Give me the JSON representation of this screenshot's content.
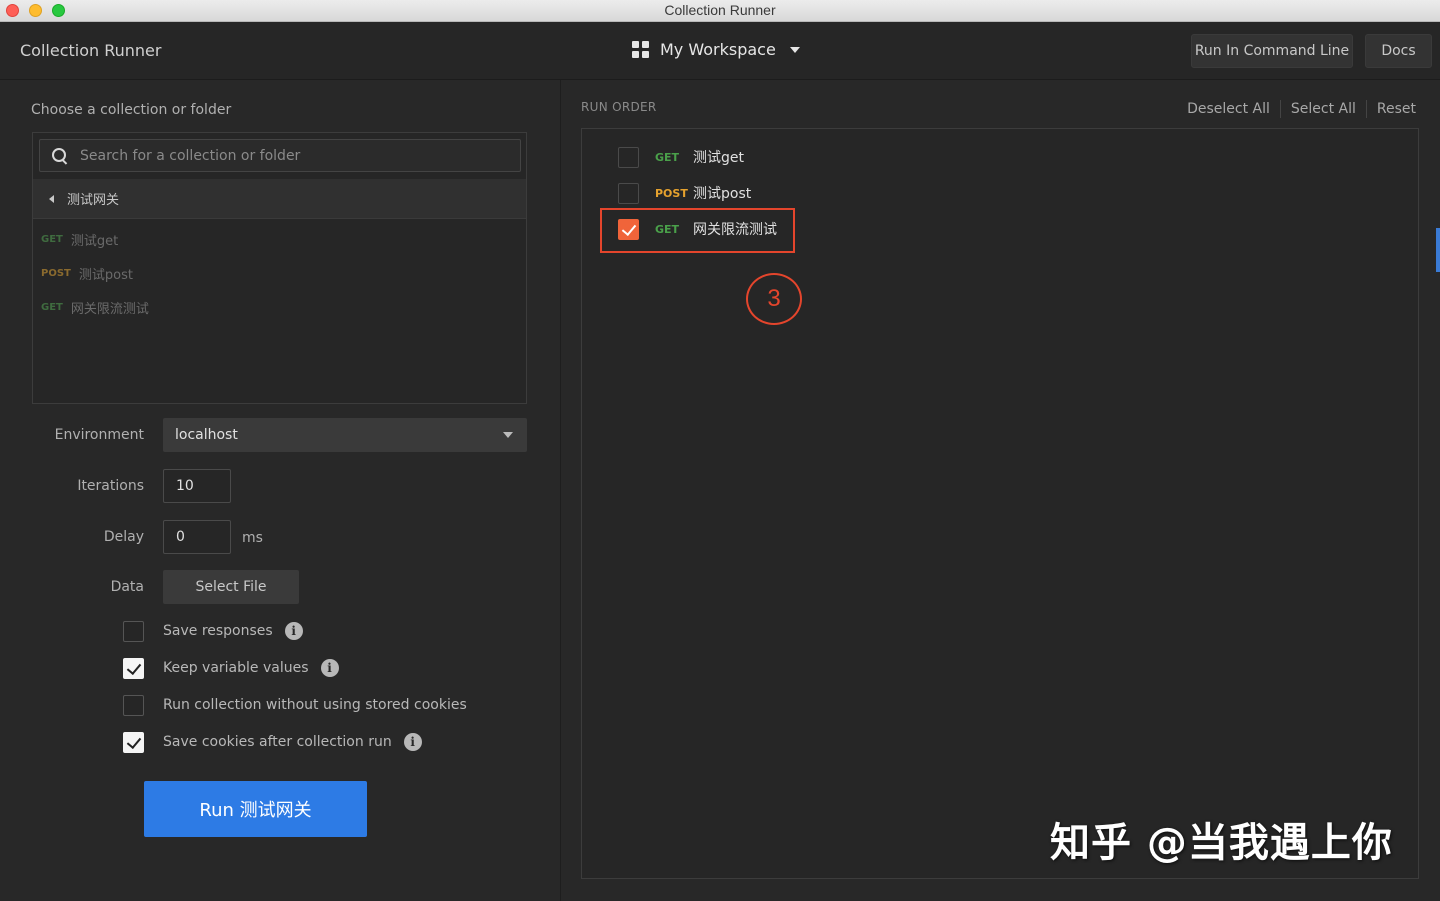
{
  "window": {
    "title": "Collection Runner"
  },
  "header": {
    "app_title": "Collection Runner",
    "workspace": "My Workspace",
    "run_cmd_label": "Run In Command Line",
    "docs_label": "Docs"
  },
  "left": {
    "choose_label": "Choose a collection or folder",
    "search_placeholder": "Search for a collection or folder",
    "folder": "测试网关",
    "items": [
      {
        "method": "GET",
        "name": "测试get"
      },
      {
        "method": "POST",
        "name": "测试post"
      },
      {
        "method": "GET",
        "name": "网关限流测试"
      }
    ],
    "environment_label": "Environment",
    "environment_value": "localhost",
    "iterations_label": "Iterations",
    "iterations_value": "10",
    "delay_label": "Delay",
    "delay_value": "0",
    "delay_unit": "ms",
    "data_label": "Data",
    "select_file_label": "Select File",
    "options": [
      {
        "label": "Save responses",
        "checked": false,
        "info": true
      },
      {
        "label": "Keep variable values",
        "checked": true,
        "info": true
      },
      {
        "label": "Run collection without using stored cookies",
        "checked": false,
        "info": false
      },
      {
        "label": "Save cookies after collection run",
        "checked": true,
        "info": true
      }
    ],
    "run_label": "Run 测试网关"
  },
  "right": {
    "run_order_label": "RUN ORDER",
    "deselect_all": "Deselect All",
    "select_all": "Select All",
    "reset": "Reset",
    "requests": [
      {
        "method": "GET",
        "name": "测试get",
        "checked": false
      },
      {
        "method": "POST",
        "name": "测试post",
        "checked": false
      },
      {
        "method": "GET",
        "name": "网关限流测试",
        "checked": true
      }
    ],
    "annotation_number": "3"
  },
  "watermark": "知乎 @当我遇上你",
  "colors": {
    "accent_blue": "#2d7be5",
    "annotation_red": "#e4452c",
    "checkbox_orange": "#f0643a",
    "get_green": "#4aa04a",
    "post_orange": "#e6a22e"
  }
}
